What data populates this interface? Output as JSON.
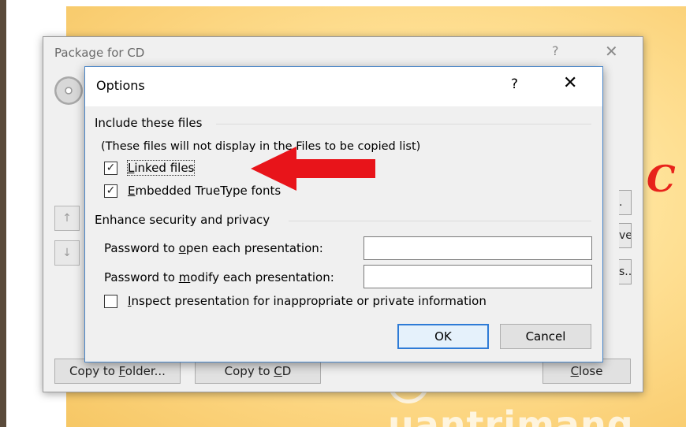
{
  "background": {
    "slide_text": "C",
    "watermark": "uantrimang"
  },
  "package_dialog": {
    "title": "Package for CD",
    "help": "?",
    "close": "✕",
    "right_buttons": [
      ".",
      "ve",
      "s..."
    ],
    "copy_to_folder": {
      "pre": "Copy to ",
      "key": "F",
      "post": "older..."
    },
    "copy_to_cd": {
      "pre": "Copy to ",
      "key": "C",
      "post": "D"
    },
    "close_button": {
      "pre": "",
      "key": "C",
      "post": "lose"
    }
  },
  "options_dialog": {
    "title": "Options",
    "help": "?",
    "close": "✕",
    "include_group": "Include these files",
    "note": "(These files will not display in the Files to be copied list)",
    "linked_files": {
      "checked": true,
      "key": "L",
      "rest": "inked files"
    },
    "embedded_fonts": {
      "checked": true,
      "key": "E",
      "rest": "mbedded TrueType fonts"
    },
    "security_group": "Enhance security and privacy",
    "password_open": {
      "pre": "Password to ",
      "key": "o",
      "post": "pen each presentation:",
      "value": ""
    },
    "password_modify": {
      "pre": "Password to ",
      "key": "m",
      "post": "odify each presentation:",
      "value": ""
    },
    "inspect": {
      "checked": false,
      "key": "I",
      "rest": "nspect presentation for inappropriate or private information"
    },
    "ok": "OK",
    "cancel": "Cancel"
  },
  "colors": {
    "arrow": "#e8141a",
    "accent": "#2e7bd6"
  }
}
